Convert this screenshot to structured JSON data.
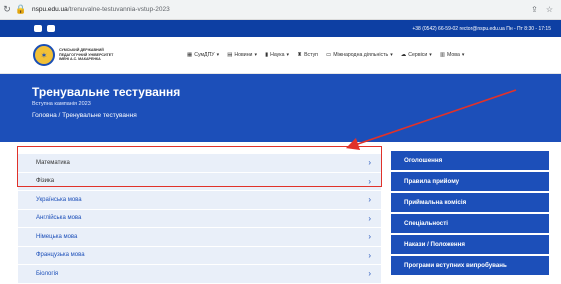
{
  "browser": {
    "reload_icon": "reload-icon",
    "url_domain": "nspu.edu.ua",
    "url_path": "/trenuvalne-testuvannia-vstup-2023",
    "share_icon": "share-icon",
    "star_icon": "star-icon"
  },
  "topbar": {
    "contacts": "+38 (0542) 66-59-02   rector@nspu.edu.ua   Пн - Пт 8:30 - 17:15"
  },
  "header": {
    "university_name": "СУМСЬКИЙ ДЕРЖАВНИЙ ПЕДАГОГІЧНИЙ УНІВЕРСИТЕТ ІМЕНІ А.С. МАКАРЕНКА",
    "nav": [
      {
        "label": "СумДПУ",
        "icon": "building-icon",
        "has_dropdown": true
      },
      {
        "label": "Новини",
        "icon": "news-icon",
        "has_dropdown": true
      },
      {
        "label": "Наука",
        "icon": "book-icon",
        "has_dropdown": true
      },
      {
        "label": "Вступ",
        "icon": "trophy-icon",
        "has_dropdown": false
      },
      {
        "label": "Міжнародна діяльність",
        "icon": "globe-icon",
        "has_dropdown": true
      },
      {
        "label": "Сервіси",
        "icon": "cloud-icon",
        "has_dropdown": true
      },
      {
        "label": "Мова",
        "icon": "language-icon",
        "has_dropdown": true
      }
    ]
  },
  "hero": {
    "title": "Тренувальне тестування",
    "subtitle": "Вступна кампанія 2023",
    "breadcrumb": "Головна  /  Тренувальне тестування"
  },
  "subjects": [
    {
      "label": "Математика"
    },
    {
      "label": "Фізика"
    },
    {
      "label": "Українська мова"
    },
    {
      "label": "Англійська мова"
    },
    {
      "label": "Німецька мова"
    },
    {
      "label": "Французька мова"
    },
    {
      "label": "Біологія"
    }
  ],
  "sidebar": [
    {
      "label": "Оголошення"
    },
    {
      "label": "Правила прийому"
    },
    {
      "label": "Приймальна комісія"
    },
    {
      "label": "Спеціальності"
    },
    {
      "label": "Накази / Положення"
    },
    {
      "label": "Програми вступних випробувань"
    }
  ],
  "colors": {
    "primary": "#1c4fb9",
    "topbar": "#0d3fa3",
    "list_bg": "#e9eff9",
    "annotation": "#e0322a"
  }
}
